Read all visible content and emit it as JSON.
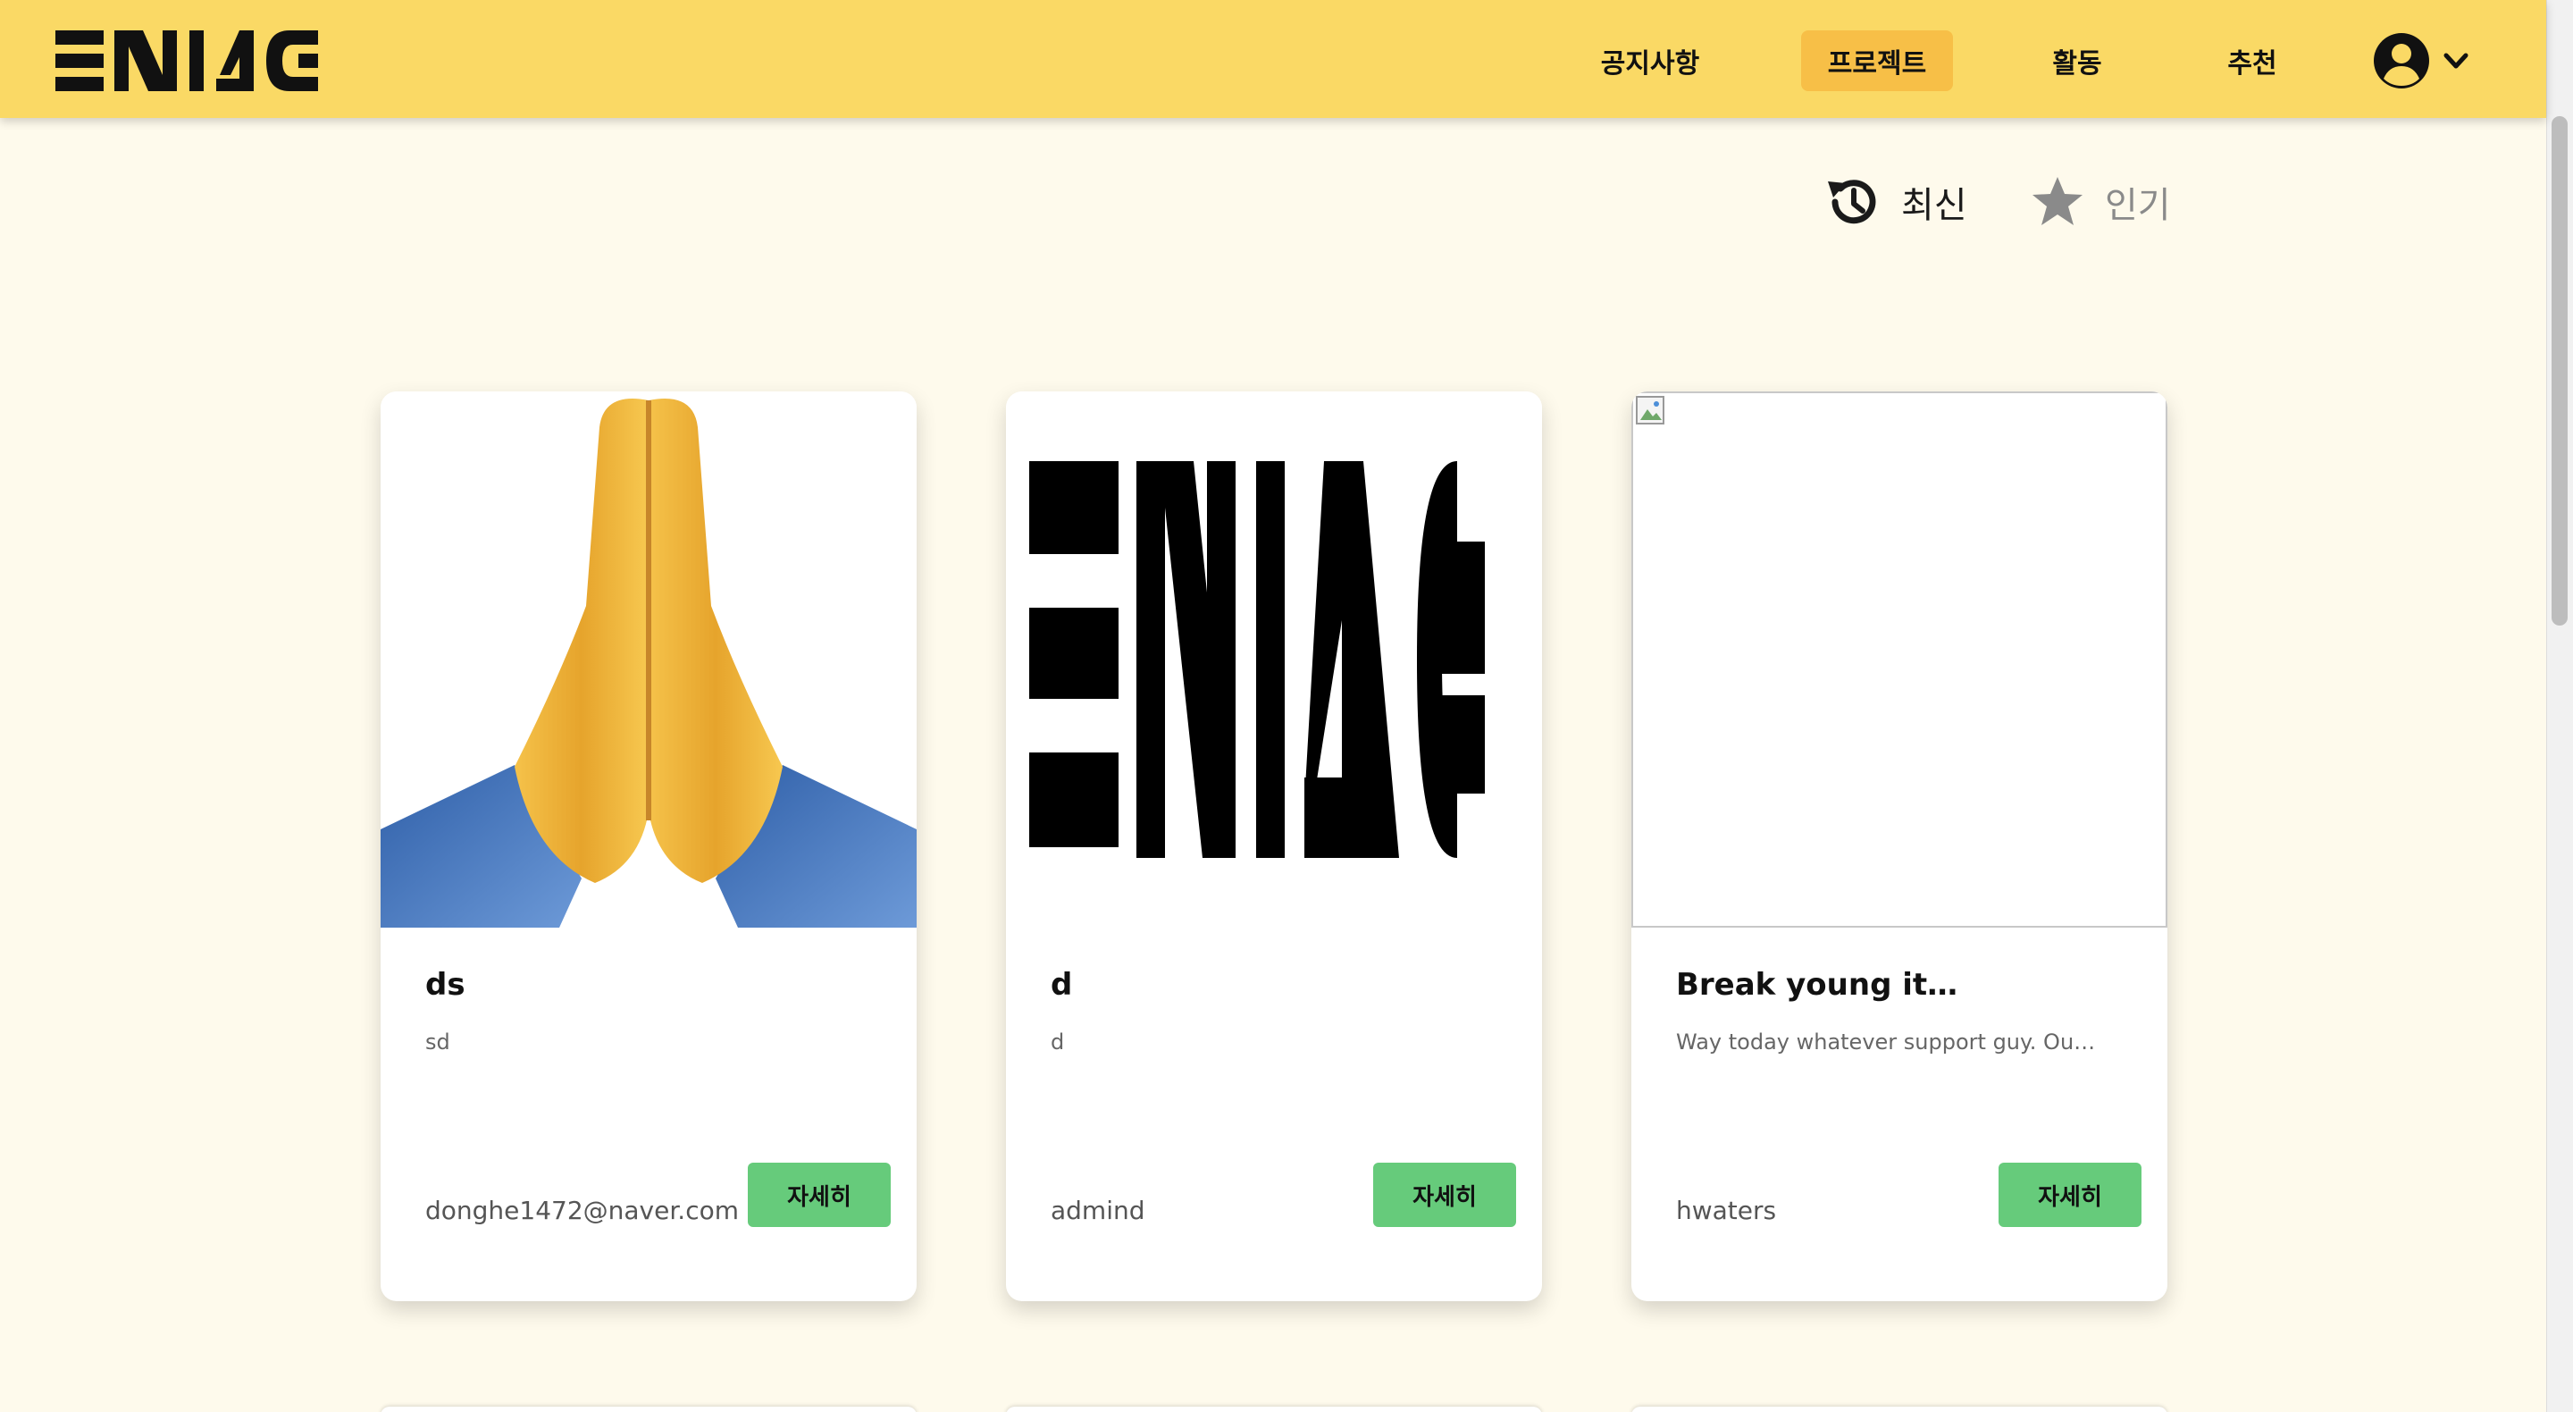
{
  "header": {
    "logo_text": "ENIAC",
    "nav": [
      {
        "label": "공지사항",
        "active": false
      },
      {
        "label": "프로젝트",
        "active": true
      },
      {
        "label": "활동",
        "active": false
      },
      {
        "label": "추천",
        "active": false
      }
    ],
    "profile_icon": "user-circle-icon",
    "dropdown_icon": "chevron-down-icon"
  },
  "sort": {
    "recent": {
      "label": "최신",
      "icon": "history-icon",
      "selected": true
    },
    "popular": {
      "label": "인기",
      "icon": "star-icon",
      "selected": false
    }
  },
  "cards": [
    {
      "title": "ds",
      "description": "sd",
      "author": "donghe1472@naver.com",
      "button": "자세히",
      "thumbnail": "folded-hands-emoji"
    },
    {
      "title": "d",
      "description": "d",
      "author": "admind",
      "button": "자세히",
      "thumbnail": "eniac-logo"
    },
    {
      "title": "Break young it…",
      "description": "Way today whatever support guy. Ou…",
      "author": "hwaters",
      "button": "자세히",
      "thumbnail": "broken-image-icon"
    }
  ],
  "colors": {
    "header": "#fad965",
    "active_nav": "#f7bf47",
    "background": "#fefaec",
    "button": "#66cb7b"
  }
}
